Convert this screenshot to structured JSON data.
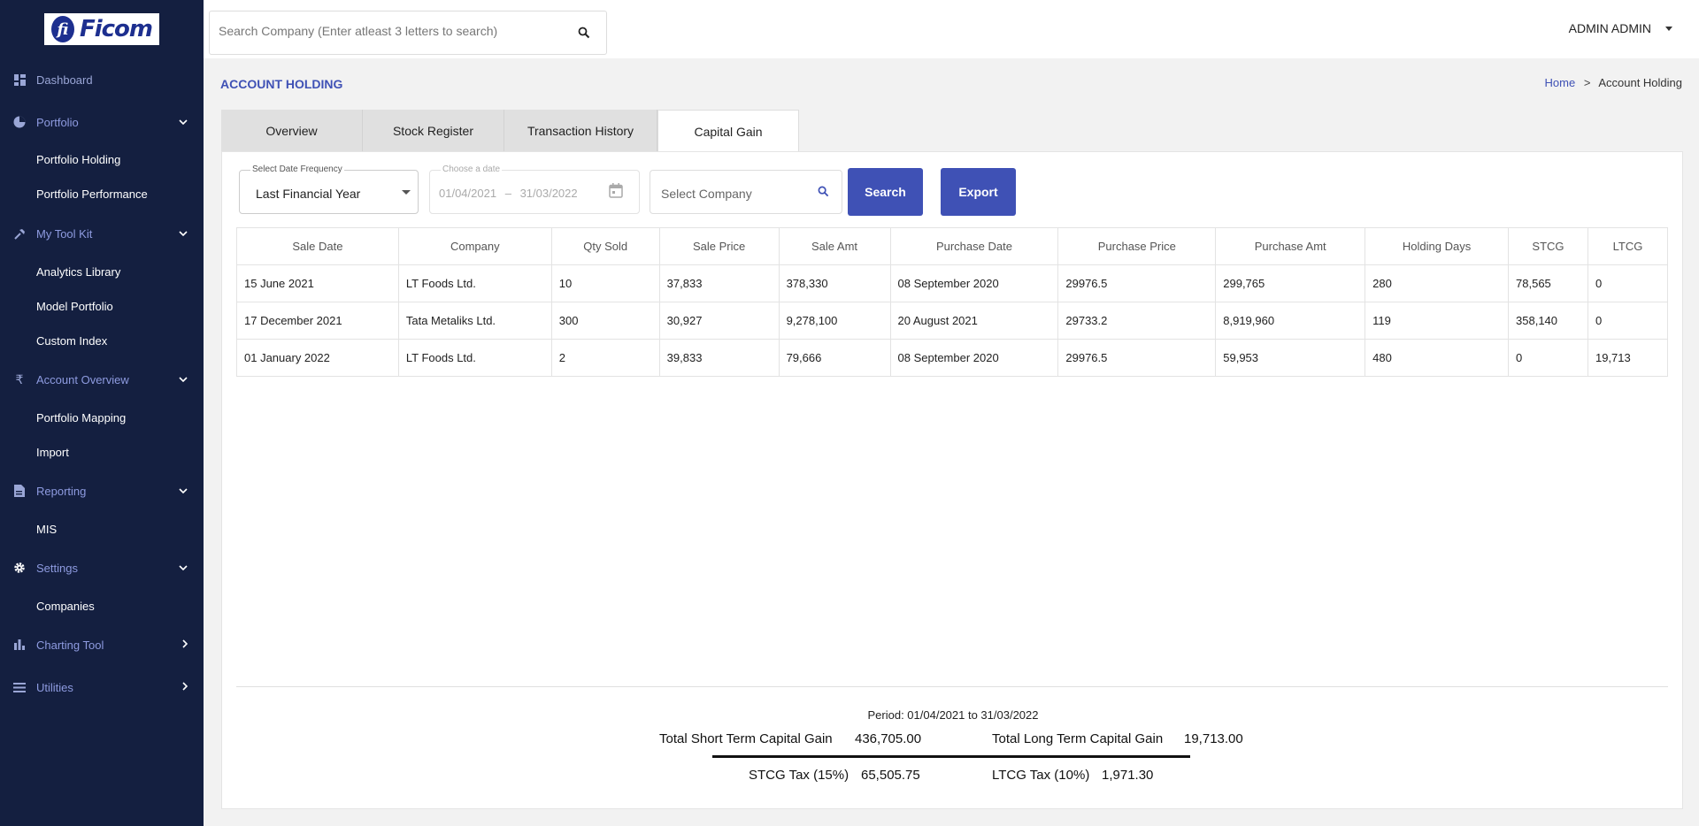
{
  "app": {
    "logo_text": "Ficom",
    "logo_mark": "fi"
  },
  "sidebar": {
    "groups": [
      {
        "label": "Dashboard",
        "icon": "dashboard-icon"
      },
      {
        "label": "Portfolio",
        "icon": "pie-chart-icon",
        "chevron": "down"
      },
      {
        "label": "My Tool Kit",
        "icon": "tool-icon",
        "chevron": "down"
      },
      {
        "label": "Account Overview",
        "icon": "rupee-icon",
        "chevron": "down"
      },
      {
        "label": "Reporting",
        "icon": "report-icon",
        "chevron": "down"
      },
      {
        "label": "Settings",
        "icon": "gear-icon",
        "chevron": "down"
      },
      {
        "label": "Charting Tool",
        "icon": "bar-chart-icon",
        "chevron": "right"
      },
      {
        "label": "Utilities",
        "icon": "menu-icon",
        "chevron": "right"
      }
    ],
    "items": [
      {
        "label": "Portfolio Holding"
      },
      {
        "label": "Portfolio Performance"
      },
      {
        "label": "Analytics Library"
      },
      {
        "label": "Model Portfolio"
      },
      {
        "label": "Custom Index"
      },
      {
        "label": "Portfolio Mapping"
      },
      {
        "label": "Import"
      },
      {
        "label": "MIS"
      },
      {
        "label": "Companies"
      }
    ]
  },
  "topbar": {
    "search_placeholder": "Search Company (Enter atleast 3 letters to search)",
    "user_name": "ADMIN ADMIN"
  },
  "page": {
    "title": "ACCOUNT HOLDING",
    "breadcrumb": {
      "home": "Home",
      "separator": ">",
      "current": "Account Holding"
    }
  },
  "tabs": [
    {
      "label": "Overview"
    },
    {
      "label": "Stock Register"
    },
    {
      "label": "Transaction History"
    },
    {
      "label": "Capital Gain",
      "active": true
    }
  ],
  "filters": {
    "frequency_label": "Select Date Frequency",
    "frequency_value": "Last Financial Year",
    "date_label": "Choose a date",
    "date_start": "01/04/2021",
    "date_sep": "–",
    "date_end": "31/03/2022",
    "company_placeholder": "Select Company",
    "search_button": "Search",
    "export_button": "Export"
  },
  "table": {
    "columns": [
      "Sale Date",
      "Company",
      "Qty Sold",
      "Sale Price",
      "Sale Amt",
      "Purchase Date",
      "Purchase Price",
      "Purchase Amt",
      "Holding Days",
      "STCG",
      "LTCG"
    ],
    "rows": [
      [
        "15 June 2021",
        "LT Foods Ltd.",
        "10",
        "37,833",
        "378,330",
        "08 September 2020",
        "29976.5",
        "299,765",
        "280",
        "78,565",
        "0"
      ],
      [
        "17 December 2021",
        "Tata Metaliks Ltd.",
        "300",
        "30,927",
        "9,278,100",
        "20 August 2021",
        "29733.2",
        "8,919,960",
        "119",
        "358,140",
        "0"
      ],
      [
        "01 January 2022",
        "LT Foods Ltd.",
        "2",
        "39,833",
        "79,666",
        "08 September 2020",
        "29976.5",
        "59,953",
        "480",
        "0",
        "19,713"
      ]
    ]
  },
  "summary": {
    "period": "Period: 01/04/2021 to 31/03/2022",
    "stcg_label": "Total Short Term Capital Gain",
    "stcg_value": "436,705.00",
    "ltcg_label": "Total Long Term Capital Gain",
    "ltcg_value": "19,713.00",
    "stcg_tax_label": "STCG Tax (15%)",
    "stcg_tax_value": "65,505.75",
    "ltcg_tax_label": "LTCG Tax (10%)",
    "ltcg_tax_value": "1,971.30"
  },
  "colors": {
    "sidebar_bg": "#141f40",
    "accent": "#3f51b5"
  }
}
